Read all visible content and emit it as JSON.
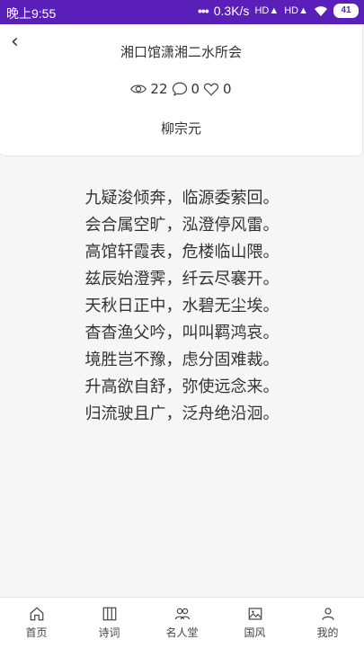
{
  "status_bar": {
    "time": "晚上9:55",
    "dots": "•••",
    "speed": "0.3K/s",
    "signal1": "HD",
    "signal2": "HD",
    "battery": "41"
  },
  "header": {
    "back_symbol": "‹",
    "title": "湘口馆潇湘二水所会",
    "views": "22",
    "comments": "0",
    "likes": "0",
    "author": "柳宗元"
  },
  "poem": {
    "lines": [
      "九疑浚倾奔，临源委萦回。",
      "会合属空旷，泓澄停风雷。",
      "高馆轩霞表，危楼临山隈。",
      "兹辰始澄霁，纤云尽褰开。",
      "天秋日正中，水碧无尘埃。",
      "杳杳渔父吟，叫叫羁鸿哀。",
      "境胜岂不豫，虑分固难裁。",
      "升高欲自舒，弥使远念来。",
      "归流驶且广，泛舟绝沿洄。"
    ]
  },
  "tabs": [
    {
      "label": "首页",
      "icon": "home-icon"
    },
    {
      "label": "诗词",
      "icon": "book-icon"
    },
    {
      "label": "名人堂",
      "icon": "people-icon"
    },
    {
      "label": "国风",
      "icon": "image-icon"
    },
    {
      "label": "我的",
      "icon": "person-icon"
    }
  ]
}
